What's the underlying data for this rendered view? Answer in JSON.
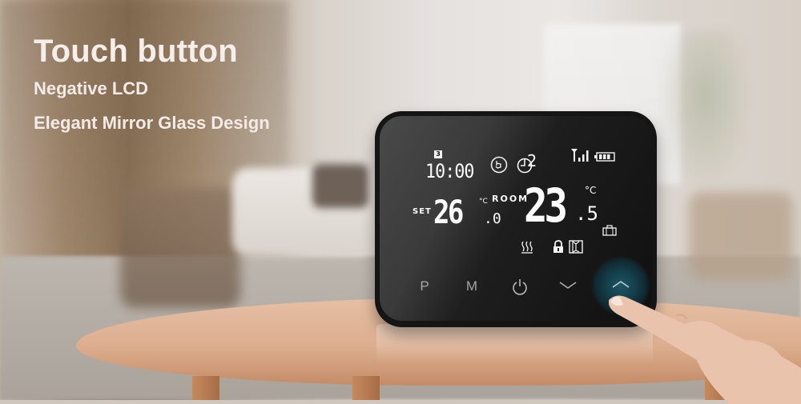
{
  "headline": {
    "title": "Touch button",
    "features": [
      "Negative LCD",
      "Elegant Mirror Glass Design"
    ]
  },
  "thermostat": {
    "display": {
      "day_indicator": "3",
      "clock": "10:00",
      "program_number": "2",
      "set_label": "SET",
      "set_temperature_int": "26",
      "set_temperature_dec": ".0",
      "set_unit": "°C",
      "room_label": "ROOM",
      "room_temperature_int": "23",
      "room_temperature_dec": ".5",
      "room_unit": "°C",
      "icons": [
        "hand-touch-icon",
        "timer-icon",
        "signal-icon",
        "battery-icon",
        "briefcase-icon",
        "heating-icon",
        "lock-icon",
        "window-icon"
      ]
    },
    "buttons": [
      {
        "name": "program",
        "label": "P"
      },
      {
        "name": "mode",
        "label": "M"
      },
      {
        "name": "power",
        "label": "⏻"
      },
      {
        "name": "down",
        "label": "﹀"
      },
      {
        "name": "up",
        "label": "︿"
      }
    ],
    "accent_color": "#1e5a69"
  }
}
